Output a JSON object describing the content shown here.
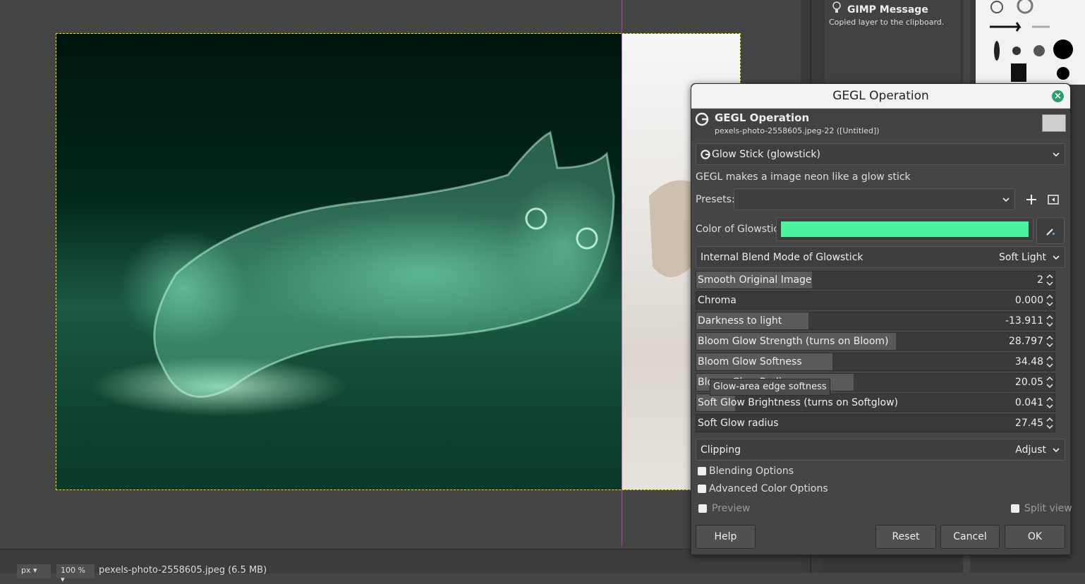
{
  "message": {
    "title": "GIMP Message",
    "body": "Copied layer to the clipboard."
  },
  "status": {
    "unit": "px",
    "zoom": "100 %",
    "file": "pexels-photo-2558605.jpeg (6.5 MB)"
  },
  "dialog": {
    "window_title": "GEGL Operation",
    "header_title": "GEGL Operation",
    "header_subtitle": "pexels-photo-2558605.jpeg-22 ([Untitled])",
    "operation": "Glow Stick (glowstick)",
    "description": "GEGL makes a image neon like a glow stick",
    "presets_label": "Presets:",
    "presets_value": "",
    "color_label": "Color of Glowstick",
    "color_value": "#4cf3a0",
    "blend_label": "Internal Blend Mode of Glowstick",
    "blend_value": "Soft Light",
    "sliders": [
      {
        "name": "Smooth Original Image",
        "value": "2",
        "fraction": 0.33
      },
      {
        "name": "Chroma",
        "value": "0.000",
        "fraction": 0.0
      },
      {
        "name": "Darkness to light",
        "value": "-13.911",
        "fraction": 0.32
      },
      {
        "name": "Bloom Glow Strength (turns on Bloom)",
        "value": "28.797",
        "fraction": 0.57
      },
      {
        "name": "Bloom Glow Softness",
        "value": "34.48",
        "fraction": 0.39
      },
      {
        "name": "Bloom Glow Radius",
        "value": "20.05",
        "fraction": 0.45
      },
      {
        "name": "Soft Glow Brightness (turns on Softglow)",
        "value": "0.041",
        "fraction": 0.11
      },
      {
        "name": "Soft Glow radius",
        "value": "27.45",
        "fraction": 0.0
      }
    ],
    "clipping_label": "Clipping",
    "clipping_value": "Adjust",
    "blending_options": "Blending Options",
    "advanced_color_options": "Advanced Color Options",
    "preview_label": "Preview",
    "split_view_label": "Split view",
    "help": "Help",
    "reset": "Reset",
    "cancel": "Cancel",
    "ok": "OK"
  },
  "tooltip": "Glow-area edge softness",
  "colors": {
    "accent": "#2e9d6d",
    "glowstick": "#4cf3a0"
  }
}
